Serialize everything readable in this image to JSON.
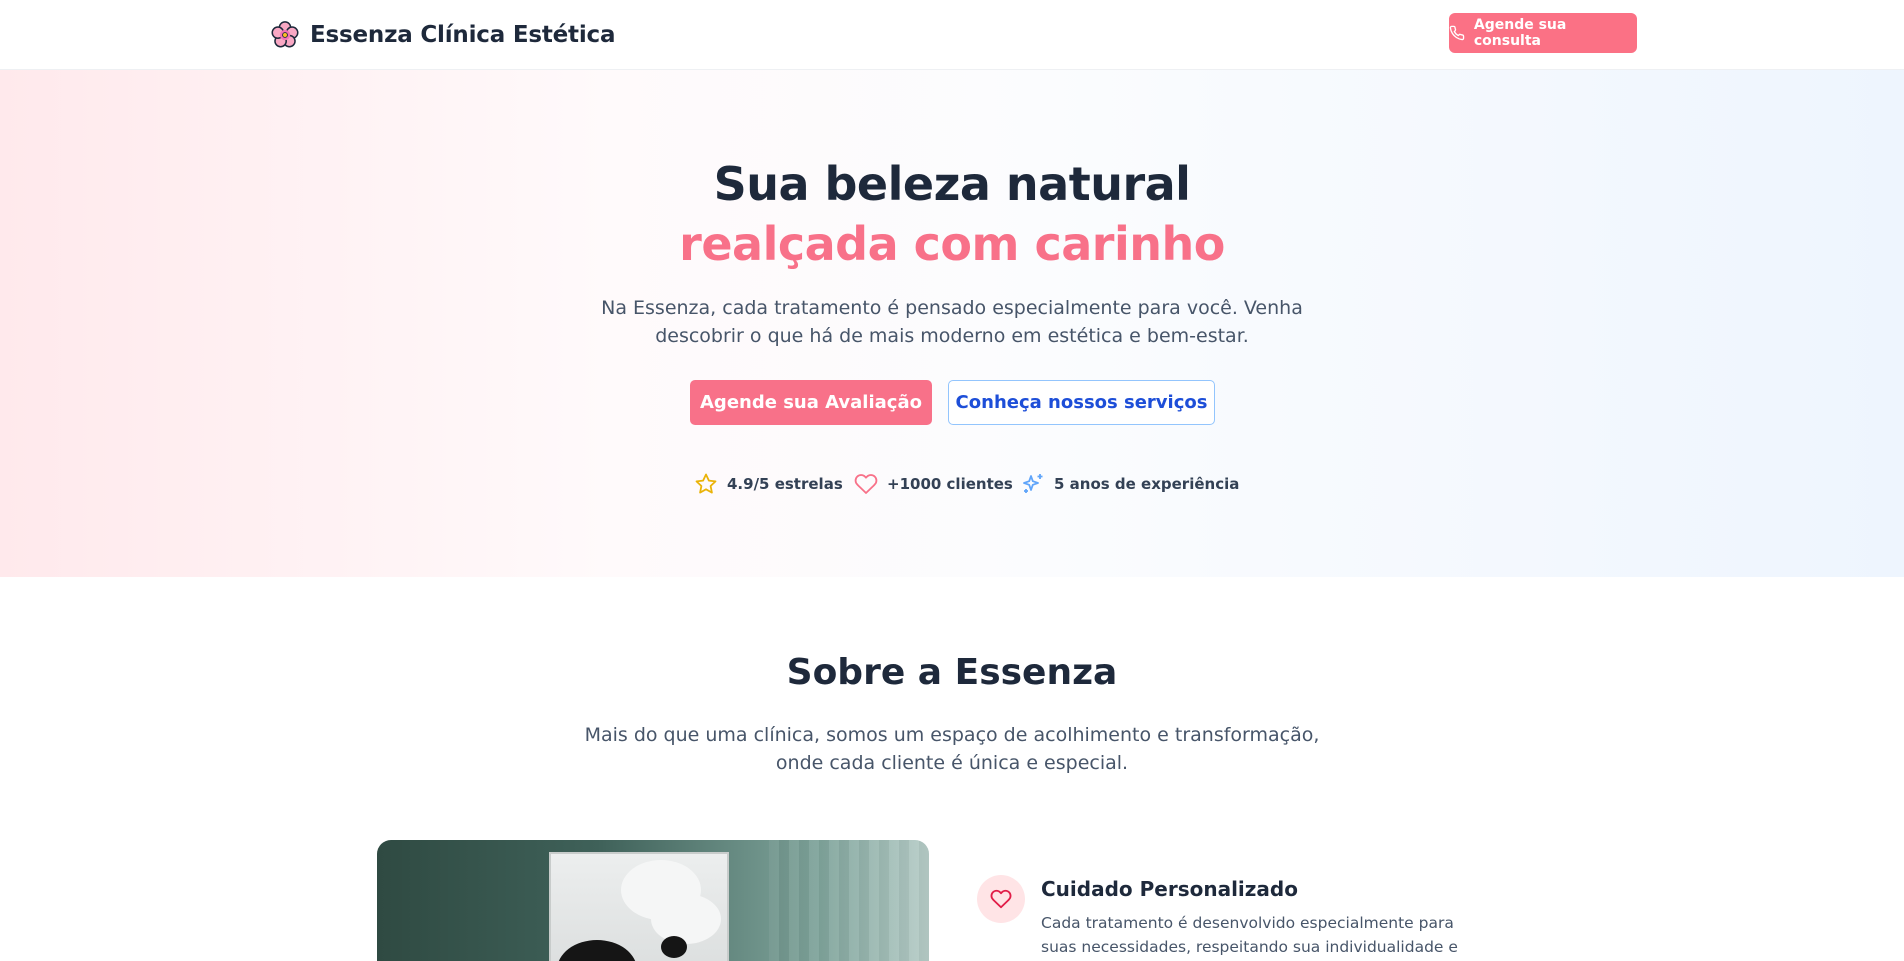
{
  "header": {
    "brand": "Essenza Clínica Estética",
    "logo_icon": "flower-icon",
    "cta_label": "Agende sua consulta",
    "cta_icon": "phone-icon"
  },
  "hero": {
    "title_line1": "Sua beleza natural",
    "title_line2": "realçada com carinho",
    "subtitle": "Na Essenza, cada tratamento é pensado especialmente para você. Venha descobrir o que há de mais moderno em estética e bem-estar.",
    "primary_button": "Agende sua Avaliação",
    "secondary_button": "Conheça nossos serviços",
    "stats": [
      {
        "icon": "star-icon",
        "label": "4.9/5 estrelas"
      },
      {
        "icon": "heart-icon",
        "label": "+1000 clientes"
      },
      {
        "icon": "sparkles-icon",
        "label": "5 anos de experiência"
      }
    ]
  },
  "about": {
    "title": "Sobre a Essenza",
    "subtitle": "Mais do que uma clínica, somos um espaço de acolhimento e transformação, onde cada cliente é única e especial.",
    "features": [
      {
        "icon": "heart-icon",
        "title": "Cuidado Personalizado",
        "text": "Cada tratamento é desenvolvido especialmente para suas necessidades, respeitando sua individualidade e objetivos."
      }
    ]
  },
  "colors": {
    "brand_pink": "#f87189",
    "text_dark": "#1e293b",
    "text_muted": "#475569",
    "link_blue": "#1d4ed8",
    "star_yellow": "#eab308",
    "sparkle_blue": "#60a5fa"
  }
}
